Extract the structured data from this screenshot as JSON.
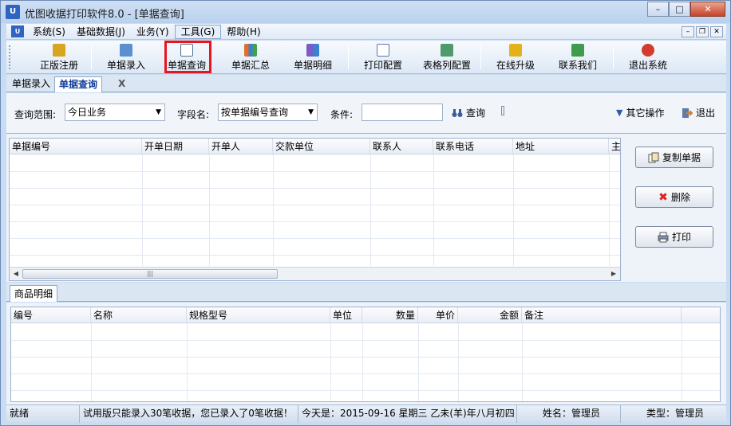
{
  "window": {
    "title": "优图收据打印软件8.0 - [单据查询]",
    "logo_text": "U",
    "minimize": "–",
    "maximize": "□",
    "close": "✕"
  },
  "menu": {
    "logo_text": "U",
    "items": [
      "系统(S)",
      "基础数据(J)",
      "业务(Y)",
      "工具(G)",
      "帮助(H)"
    ],
    "active_index": 3,
    "mdi": [
      "–",
      "❐",
      "✕"
    ]
  },
  "toolbar": {
    "buttons": [
      {
        "label": "正版注册",
        "icon": "lock-icon",
        "color": "#d9a520"
      },
      {
        "label": "单据录入",
        "icon": "edit-icon",
        "color": "#5a8fd0"
      },
      {
        "label": "单据查询",
        "icon": "search-doc-icon",
        "color": "#4d6f9a"
      },
      {
        "label": "单据汇总",
        "icon": "bar-chart-icon",
        "color": "#e0702a"
      },
      {
        "label": "单据明细",
        "icon": "chart-detail-icon",
        "color": "#7b5bc7"
      },
      {
        "label": "打印配置",
        "icon": "print-config-icon",
        "color": "#5a7aa8"
      },
      {
        "label": "表格列配置",
        "icon": "table-config-icon",
        "color": "#4f9a6a"
      },
      {
        "label": "在线升级",
        "icon": "upgrade-icon",
        "color": "#e3b21a"
      },
      {
        "label": "联系我们",
        "icon": "home-icon",
        "color": "#3f9c4c"
      },
      {
        "label": "退出系统",
        "icon": "exit-icon",
        "color": "#d33b2c"
      }
    ]
  },
  "tabs": {
    "items": [
      "单据录入",
      "单据查询"
    ],
    "active_index": 1,
    "close": "X"
  },
  "query": {
    "range_label": "查询范围:",
    "range_value": "今日业务",
    "field_label": "字段名:",
    "field_value": "按单据编号查询",
    "condition_label": "条件:",
    "condition_value": "",
    "search_label": "查询",
    "other_label": "其它操作",
    "exit_label": "退出"
  },
  "grid": {
    "columns": [
      "单据编号",
      "开单日期",
      "开单人",
      "交款单位",
      "联系人",
      "联系电话",
      "地址",
      "主"
    ]
  },
  "side_buttons": {
    "copy": "复制单据",
    "delete": "删除",
    "print": "打印"
  },
  "detail": {
    "tab_label": "商品明细",
    "columns": [
      "编号",
      "名称",
      "规格型号",
      "单位",
      "数量",
      "单价",
      "金额",
      "备注"
    ]
  },
  "status": {
    "ready": "就绪",
    "trial": "试用版只能录入30笔收据，您已录入了0笔收据！",
    "today": "今天是：2015-09-16 星期三 乙未(羊)年八月初四",
    "user": "姓名：管理员",
    "type": "类型：管理员"
  },
  "colors": {
    "highlight": "#e8141e",
    "frame": "#c9dcf2"
  }
}
